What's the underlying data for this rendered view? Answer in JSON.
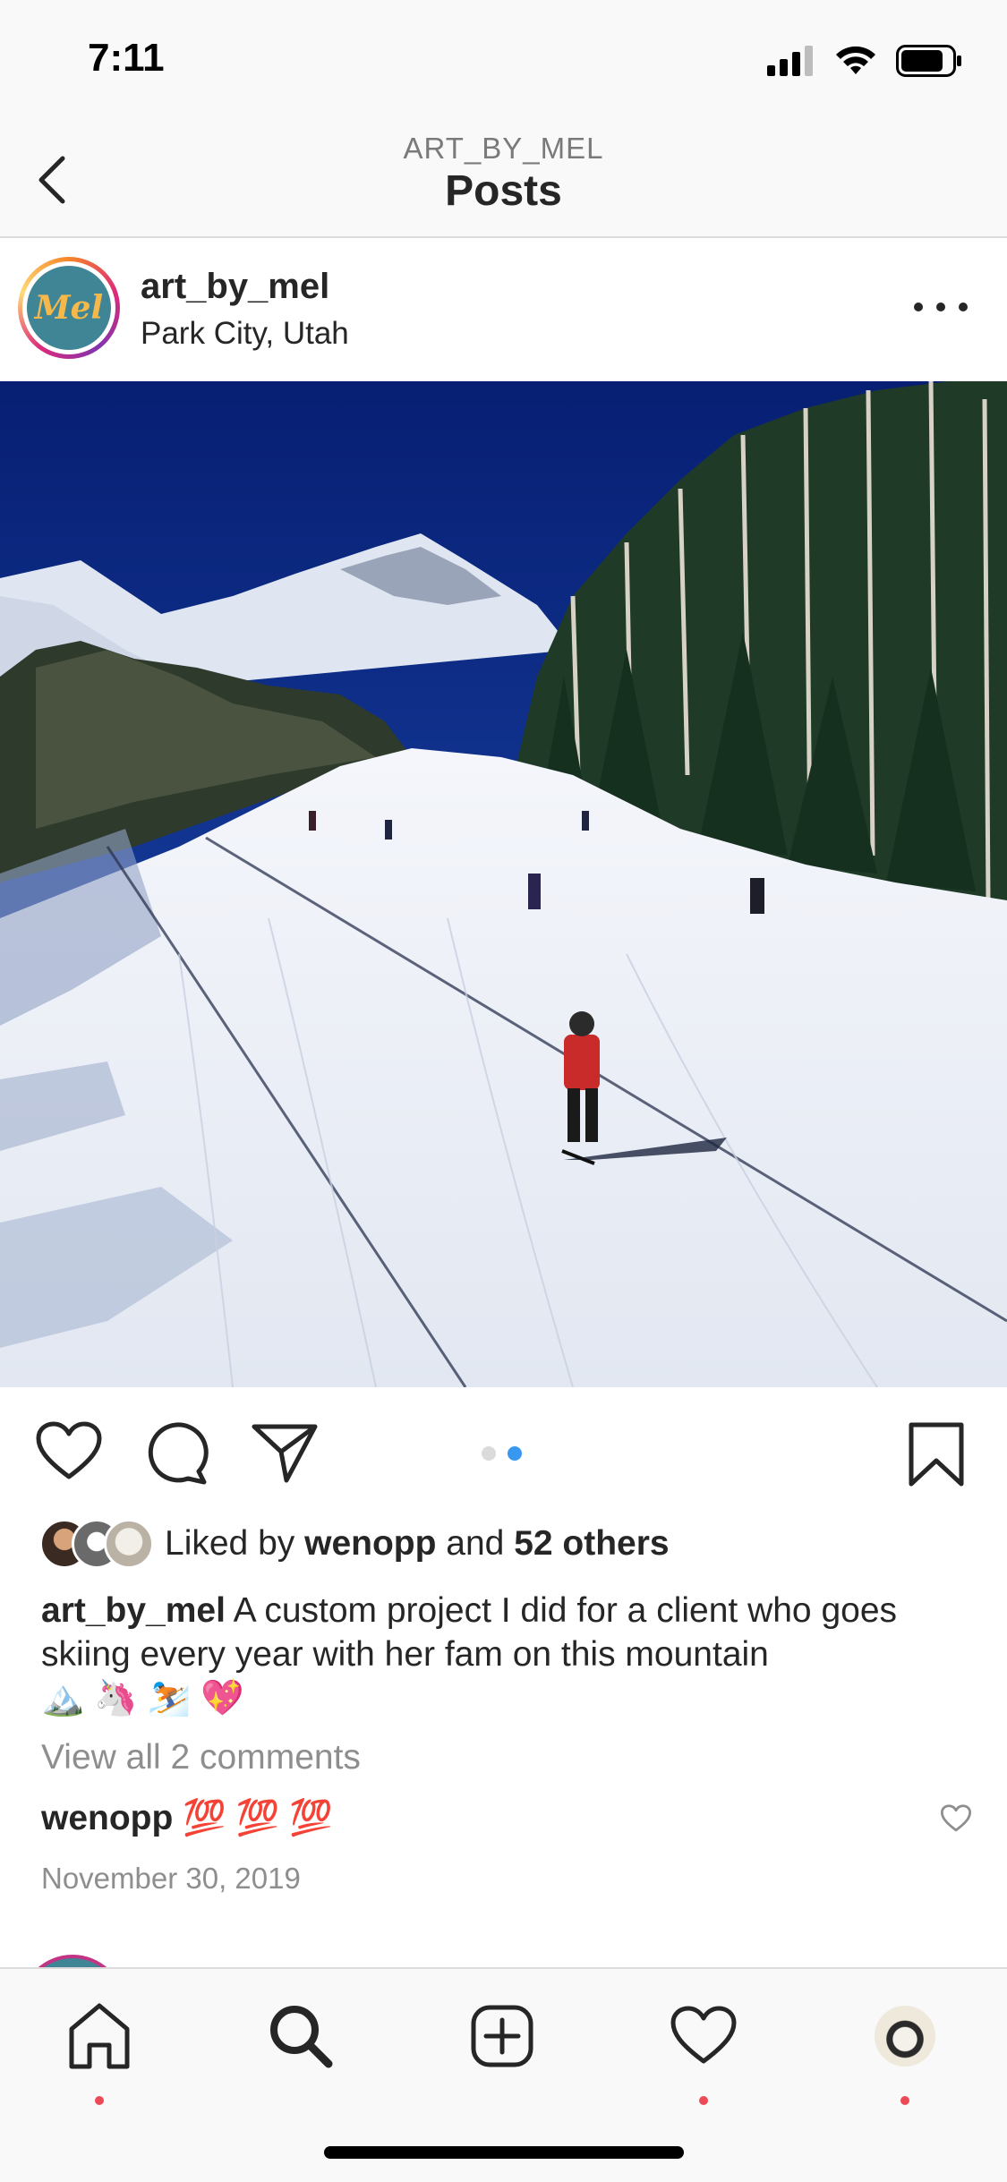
{
  "status_bar": {
    "time": "7:11"
  },
  "nav": {
    "subtitle": "ART_BY_MEL",
    "title": "Posts"
  },
  "post": {
    "avatar_text": "Mel",
    "username": "art_by_mel",
    "location": "Park City, Utah",
    "carousel": {
      "count": 2,
      "active_index": 1
    },
    "likes": {
      "prefix": "Liked by ",
      "user": "wenopp",
      "middle": " and ",
      "others": "52 others"
    },
    "caption": {
      "username": "art_by_mel",
      "text": " A custom project I did for a client who goes skiing every year with her fam on this mountain",
      "emojis": "🏔️ 🦄 ⛷️ 💖"
    },
    "view_comments": "View all 2 comments",
    "comment": {
      "username": "wenopp",
      "text": "💯 💯 💯"
    },
    "date": "November 30, 2019"
  },
  "colors": {
    "notification_dot": "#ed4956",
    "carousel_active": "#3897f0",
    "carousel_inactive": "#dbdbdb",
    "sky": "#0b2a86"
  },
  "icons": [
    "back-chevron-icon",
    "more-options-icon",
    "heart-icon",
    "comment-icon",
    "share-icon",
    "bookmark-icon",
    "home-icon",
    "search-icon",
    "add-icon",
    "activity-heart-icon"
  ]
}
